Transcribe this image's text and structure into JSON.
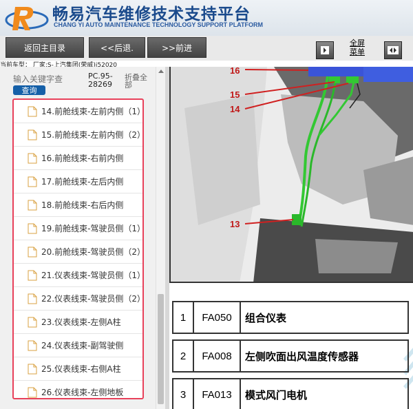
{
  "header": {
    "title_cn": "畅易汽车维修技术支持平台",
    "title_en": "CHANG YI AUTO MAINTENANCE TECHNOLOGY SUPPORT PLATFORM"
  },
  "toolbar": {
    "back_main": "返回主目录",
    "back": "<<后退.",
    "forward": ">>前进",
    "fullscreen_line1": "全屏",
    "fullscreen_line2": "菜单"
  },
  "current_model": "当前车型： 厂家:S-上汽集团(荣威)i52020",
  "search": {
    "placeholder": "输入关键字查",
    "button": "查询"
  },
  "pc_text": "PC.95-28269",
  "fold_text": "折叠全部",
  "tree_items": [
    "14.前舱线束-左前内侧（1）",
    "15.前舱线束-左前内侧（2）",
    "16.前舱线束-右前内侧",
    "17.前舱线束-左后内侧",
    "18.前舱线束-右后内侧",
    "19.前舱线束-驾驶员侧（1）",
    "20.前舱线束-驾驶员侧（2）",
    "21.仪表线束-驾驶员侧（1）",
    "22.仪表线束-驾驶员侧（2）",
    "23.仪表线束-左侧A柱",
    "24.仪表线束-副驾驶侧",
    "25.仪表线束-右侧A柱",
    "26.仪表线束-左侧地板"
  ],
  "diagram_callouts": [
    "16",
    "15",
    "14",
    "13"
  ],
  "components": [
    {
      "num": "1",
      "code": "FA050",
      "name": "组合仪表"
    },
    {
      "num": "2",
      "code": "FA008",
      "name": "左侧吹面出风温度传感器"
    },
    {
      "num": "3",
      "code": "FA013",
      "name": "模式风门电机"
    }
  ]
}
